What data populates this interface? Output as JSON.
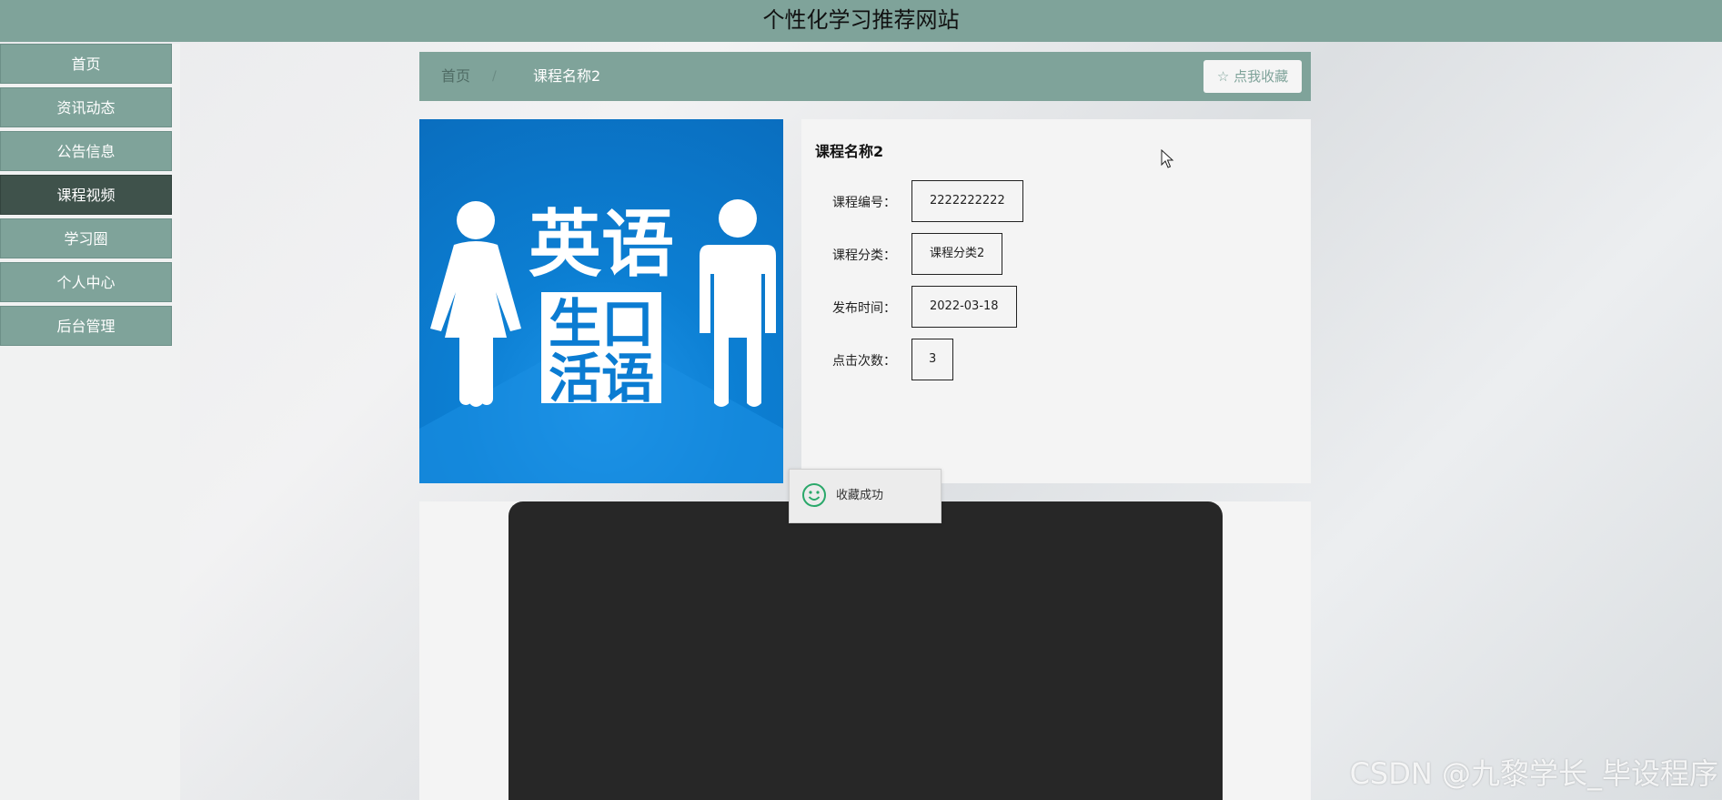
{
  "header": {
    "title": "个性化学习推荐网站"
  },
  "sidebar": {
    "items": [
      {
        "label": "首页"
      },
      {
        "label": "资讯动态"
      },
      {
        "label": "公告信息"
      },
      {
        "label": "课程视频",
        "active": true
      },
      {
        "label": "学习圈"
      },
      {
        "label": "个人中心"
      },
      {
        "label": "后台管理"
      }
    ]
  },
  "breadcrumb": {
    "home": "首页",
    "separator": "/",
    "current": "课程名称2"
  },
  "favorite_button": {
    "label": "点我收藏",
    "icon": "star-outline-icon"
  },
  "course": {
    "image": {
      "text_top": "英语",
      "text_bottom_1": "生口",
      "text_bottom_2": "活语"
    },
    "name": "课程名称2",
    "fields": [
      {
        "label": "课程编号：",
        "value": "2222222222"
      },
      {
        "label": "课程分类：",
        "value": "课程分类2"
      },
      {
        "label": "发布时间：",
        "value": "2022-03-18"
      },
      {
        "label": "点击次数：",
        "value": "3"
      }
    ]
  },
  "toast": {
    "text": "收藏成功",
    "icon": "smile-icon"
  },
  "watermark": {
    "text": "CSDN @九黎学长_毕设程序"
  },
  "colors": {
    "primary": "#7fa39a",
    "active": "#3f524b",
    "video": "#272727"
  }
}
